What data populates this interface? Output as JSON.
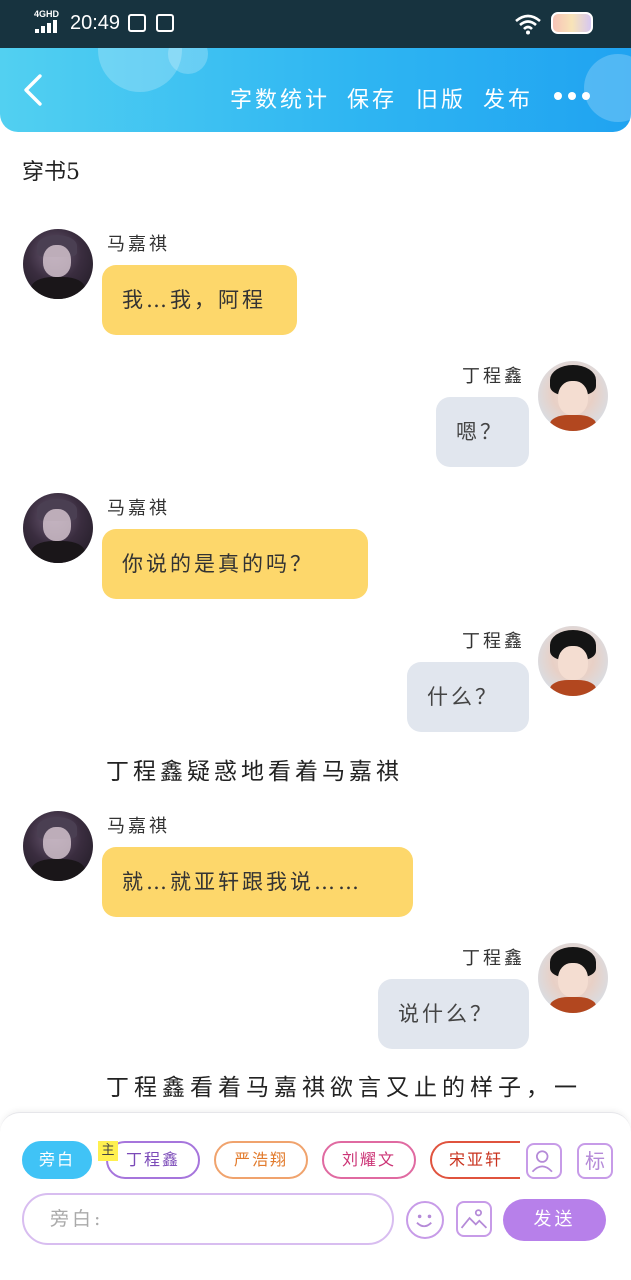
{
  "status_bar": {
    "network": "4GHD",
    "time": "20:49"
  },
  "header": {
    "actions": [
      {
        "id": "word_count",
        "label": "字数统计"
      },
      {
        "id": "save",
        "label": "保存"
      },
      {
        "id": "old_version",
        "label": "旧版"
      },
      {
        "id": "publish",
        "label": "发布"
      }
    ]
  },
  "chapter_title": "穿书5",
  "messages": [
    {
      "speaker": "马嘉祺",
      "side": "left",
      "text": "我…我，阿程"
    },
    {
      "speaker": "丁程鑫",
      "side": "right",
      "text": "嗯？"
    },
    {
      "speaker": "马嘉祺",
      "side": "left",
      "text": "你说的是真的吗？"
    },
    {
      "speaker": "丁程鑫",
      "side": "right",
      "text": "什么？"
    },
    {
      "narration": "丁程鑫疑惑地看着马嘉祺"
    },
    {
      "speaker": "马嘉祺",
      "side": "left",
      "text": "就…就亚轩跟我说……"
    },
    {
      "speaker": "丁程鑫",
      "side": "right",
      "text": "说什么？"
    },
    {
      "narration": "丁程鑫看着马嘉祺欲言又止的样子，一"
    }
  ],
  "composer": {
    "roles": [
      "旁白",
      "丁程鑫",
      "严浩翔",
      "刘耀文",
      "宋亚轩"
    ],
    "main_badge": "主",
    "tag_label": "标",
    "input_placeholder": "旁白:",
    "send_label": "发送"
  },
  "colors": {
    "header_gradient_start": "#52d0f1",
    "header_gradient_end": "#20a3f1",
    "left_bubble": "#fdd76b",
    "right_bubble": "#e1e6ee",
    "send_button": "#b780ea"
  }
}
